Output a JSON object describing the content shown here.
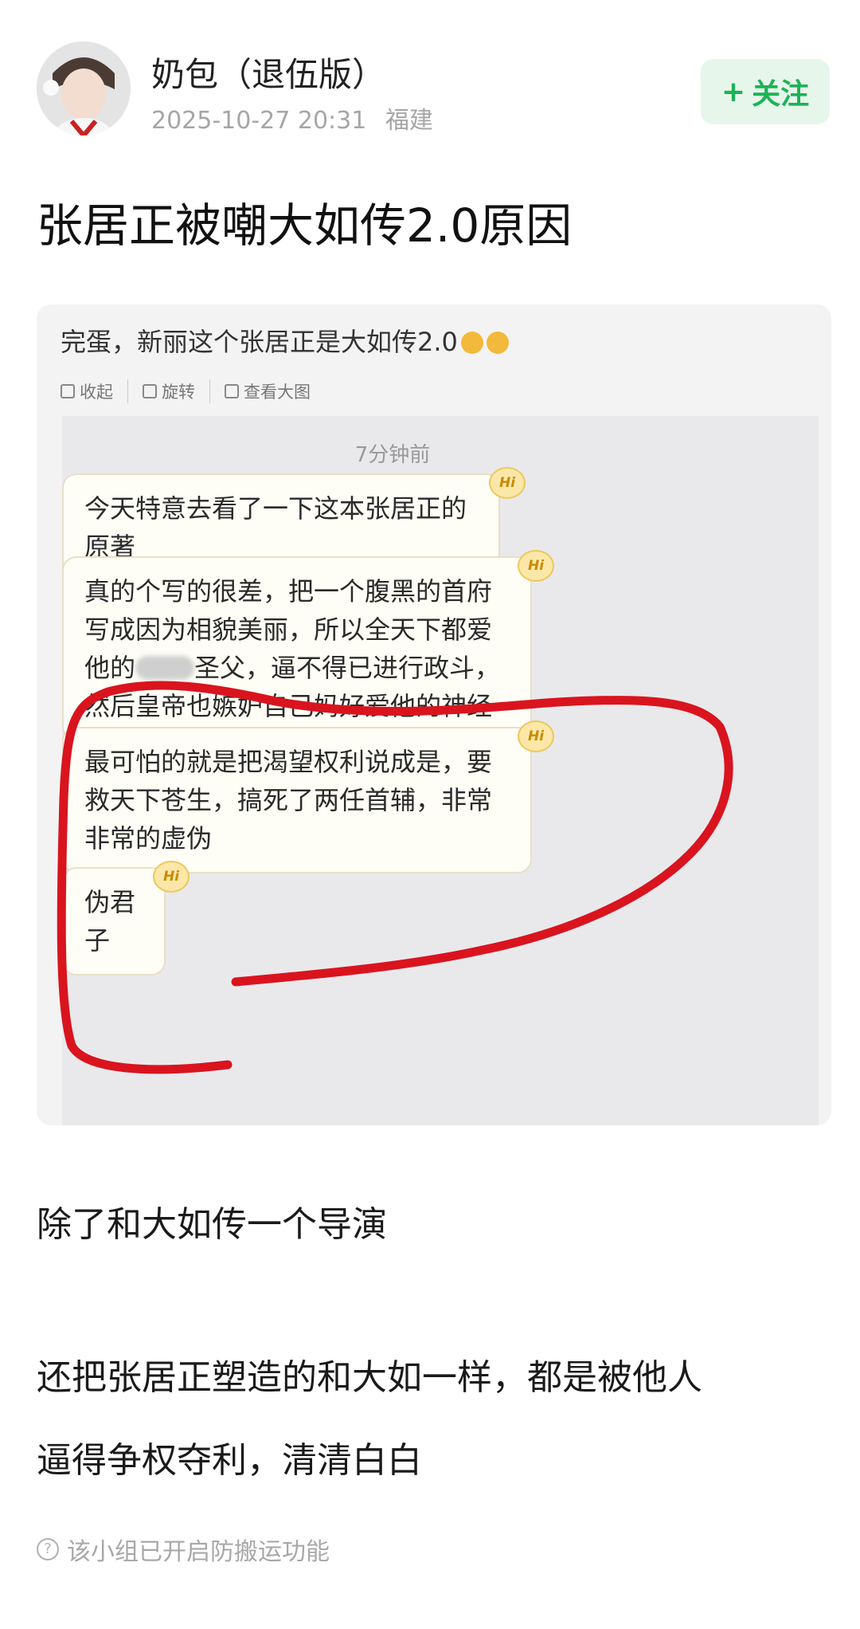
{
  "post": {
    "author": "奶包（退伍版）",
    "timestamp": "2025-10-27 20:31",
    "location": "福建",
    "follow_label": "关注",
    "title": "张居正被嘲大如传2.0原因"
  },
  "screenshot": {
    "caption": "完蛋，新丽这个张居正是大如传2.0",
    "tools": [
      {
        "label": "收起",
        "icon": "collapse-icon"
      },
      {
        "label": "旋转",
        "icon": "rotate-icon"
      },
      {
        "label": "查看大图",
        "icon": "zoom-icon"
      }
    ],
    "chat_time": "7分钟前",
    "messages": [
      "今天特意去看了一下这本张居正的原著",
      "真的个写的很差，把一个腹黑的首府写成因为相貌美丽，所以全天下都爱他的",
      "圣父，逼不得已进行政斗，然后皇帝也嫉妒自己妈好爱他的神经",
      "最可怕的就是把渴望权利说成是，要救天下苍生，搞死了两任首辅，非常非常的虚伪",
      "伪君子"
    ],
    "badge": "Hi",
    "highlight_color": "#d9141e"
  },
  "body": {
    "line1": "除了和大如传一个导演",
    "line2": "还把张居正塑造的和大如一样，都是被他人",
    "line3": "逼得争权夺利，清清白白"
  },
  "footer": {
    "note": "该小组已开启防搬运功能"
  }
}
